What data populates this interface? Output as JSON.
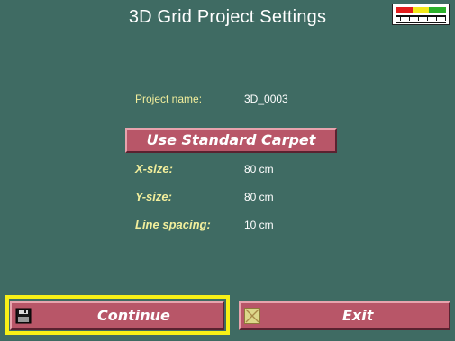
{
  "window": {
    "title": "3D Grid Project Settings"
  },
  "status_meter": {
    "icon": "signal-meter-icon",
    "colors": [
      "#e21c1c",
      "#f3e91a",
      "#2bb02b"
    ]
  },
  "project": {
    "name_label": "Project name:",
    "name_value": "3D_0003"
  },
  "carpet_button": {
    "label": "Use Standard Carpet"
  },
  "dimensions": {
    "x_label": "X-size:",
    "x_value": "80 cm",
    "y_label": "Y-size:",
    "y_value": "80 cm",
    "spacing_label": "Line spacing:",
    "spacing_value": "10 cm"
  },
  "footer": {
    "continue_label": "Continue",
    "continue_icon": "floppy-disk-icon",
    "exit_label": "Exit",
    "exit_icon": "close-x-icon"
  },
  "theme": {
    "background": "#3f6b63",
    "button": "#b85668",
    "focus_frame": "#f7f017",
    "label_text": "#f2ee9c"
  }
}
